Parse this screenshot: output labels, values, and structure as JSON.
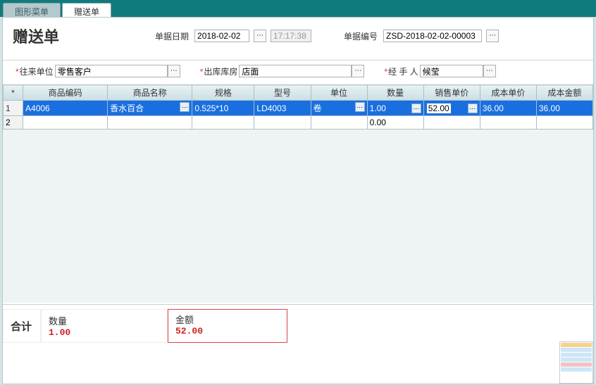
{
  "tabs": {
    "menu": "图形菜单",
    "form": "赠送单"
  },
  "title": "赠送单",
  "header": {
    "date_label": "单据日期",
    "date": "2018-02-02",
    "time": "17:17:38",
    "no_label": "单据编号",
    "no": "ZSD-2018-02-02-00003"
  },
  "fields": {
    "unit_label": "往来单位",
    "unit": "零售客户",
    "wh_label": "出库库房",
    "wh": "店面",
    "person_label": "经 手 人",
    "person": "候莹"
  },
  "grid": {
    "headers": {
      "star": "*",
      "code": "商品编码",
      "name": "商品名称",
      "spec": "规格",
      "model": "型号",
      "uom": "单位",
      "qty": "数量",
      "price": "销售单价",
      "cost_price": "成本单价",
      "cost_amount": "成本金额"
    },
    "r1": {
      "num": "1",
      "code": "A4006",
      "name": "香水百合",
      "spec": "0.525*10",
      "model": "LD4003",
      "uom": "卷",
      "qty": "1.00",
      "price": "52.00",
      "cost_price": "36.00",
      "cost_amount": "36.00"
    },
    "r2": {
      "num": "2",
      "qty": "0.00"
    }
  },
  "footer": {
    "total_label": "合计",
    "qty_label": "数量",
    "qty": "1.00",
    "amount_label": "金额",
    "amount": "52.00"
  }
}
